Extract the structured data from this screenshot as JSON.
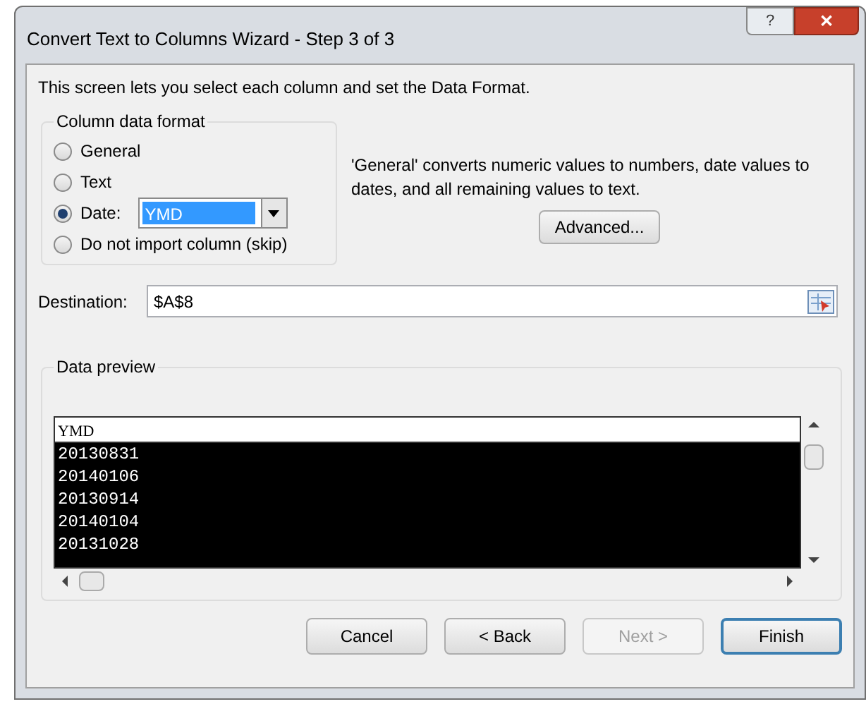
{
  "window": {
    "title": "Convert Text to Columns Wizard - Step 3 of 3",
    "help_button": "?",
    "close_button": "✕"
  },
  "intro": "This screen lets you select each column and set the Data Format.",
  "column_data_format": {
    "legend": "Column data format",
    "options": [
      {
        "label": "General",
        "selected": false
      },
      {
        "label": "Text",
        "selected": false
      },
      {
        "label": "Date:",
        "selected": true,
        "kind": "date",
        "date_format": "YMD"
      },
      {
        "label": "Do not import column (skip)",
        "selected": false
      }
    ]
  },
  "description": "'General' converts numeric values to numbers, date values to dates, and all remaining values to text.",
  "advanced_button": "Advanced...",
  "destination": {
    "label": "Destination:",
    "value": "$A$8"
  },
  "data_preview": {
    "legend": "Data preview",
    "columns": [
      {
        "header": "YMD",
        "selected": true,
        "values": [
          "20130831",
          "20140106",
          "20130914",
          "20140104",
          "20131028"
        ]
      }
    ]
  },
  "buttons": [
    {
      "label": "Cancel",
      "disabled": false,
      "default": false
    },
    {
      "label": "< Back",
      "disabled": false,
      "default": false
    },
    {
      "label": "Next >",
      "disabled": true,
      "default": false
    },
    {
      "label": "Finish",
      "disabled": false,
      "default": true
    }
  ]
}
